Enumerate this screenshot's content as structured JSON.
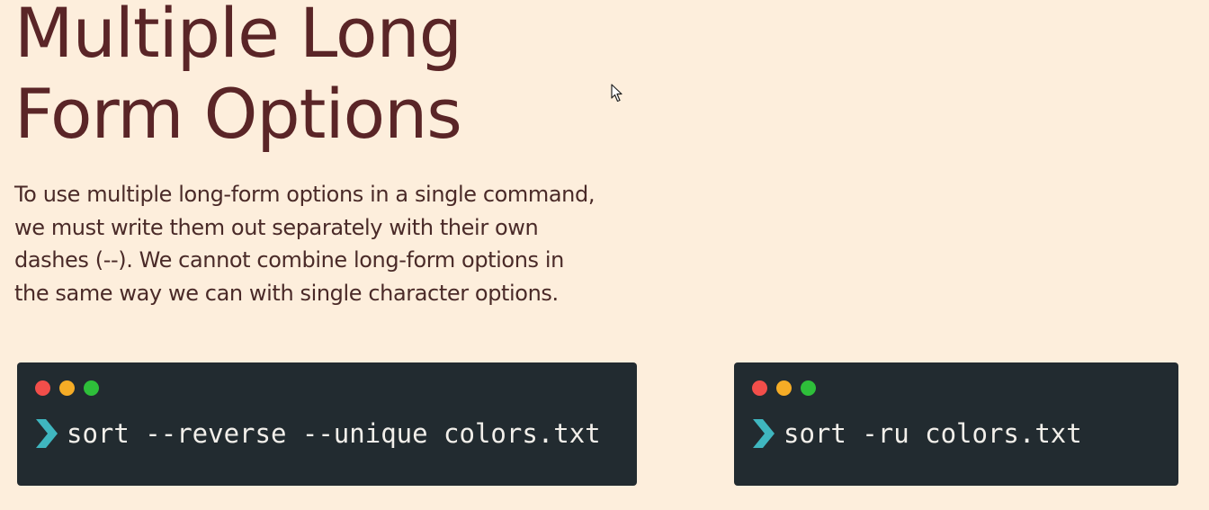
{
  "slide": {
    "title_lines": [
      "Multiple Long",
      "Form Options"
    ],
    "body_lines": [
      "To use multiple long-form options in a single command,",
      "we must write them out separately with their own",
      "dashes (--).  We cannot combine long-form options in",
      "the same way we can with single character options."
    ]
  },
  "terminals": [
    {
      "command": "sort --reverse --unique colors.txt",
      "prompt_icon": "chevron-right-icon"
    },
    {
      "command": "sort -ru colors.txt",
      "prompt_icon": "chevron-right-icon"
    }
  ],
  "colors": {
    "background": "#FDEEDC",
    "title": "#5A2527",
    "body_text": "#4A2A28",
    "terminal_bg": "#222B30",
    "terminal_text": "#F2EFEA",
    "prompt_accent": "#3FB6BF",
    "dot_red": "#F24E4A",
    "dot_yellow": "#F5AC26",
    "dot_green": "#2EBF3A"
  },
  "cursor_icon": "mouse-pointer-icon"
}
